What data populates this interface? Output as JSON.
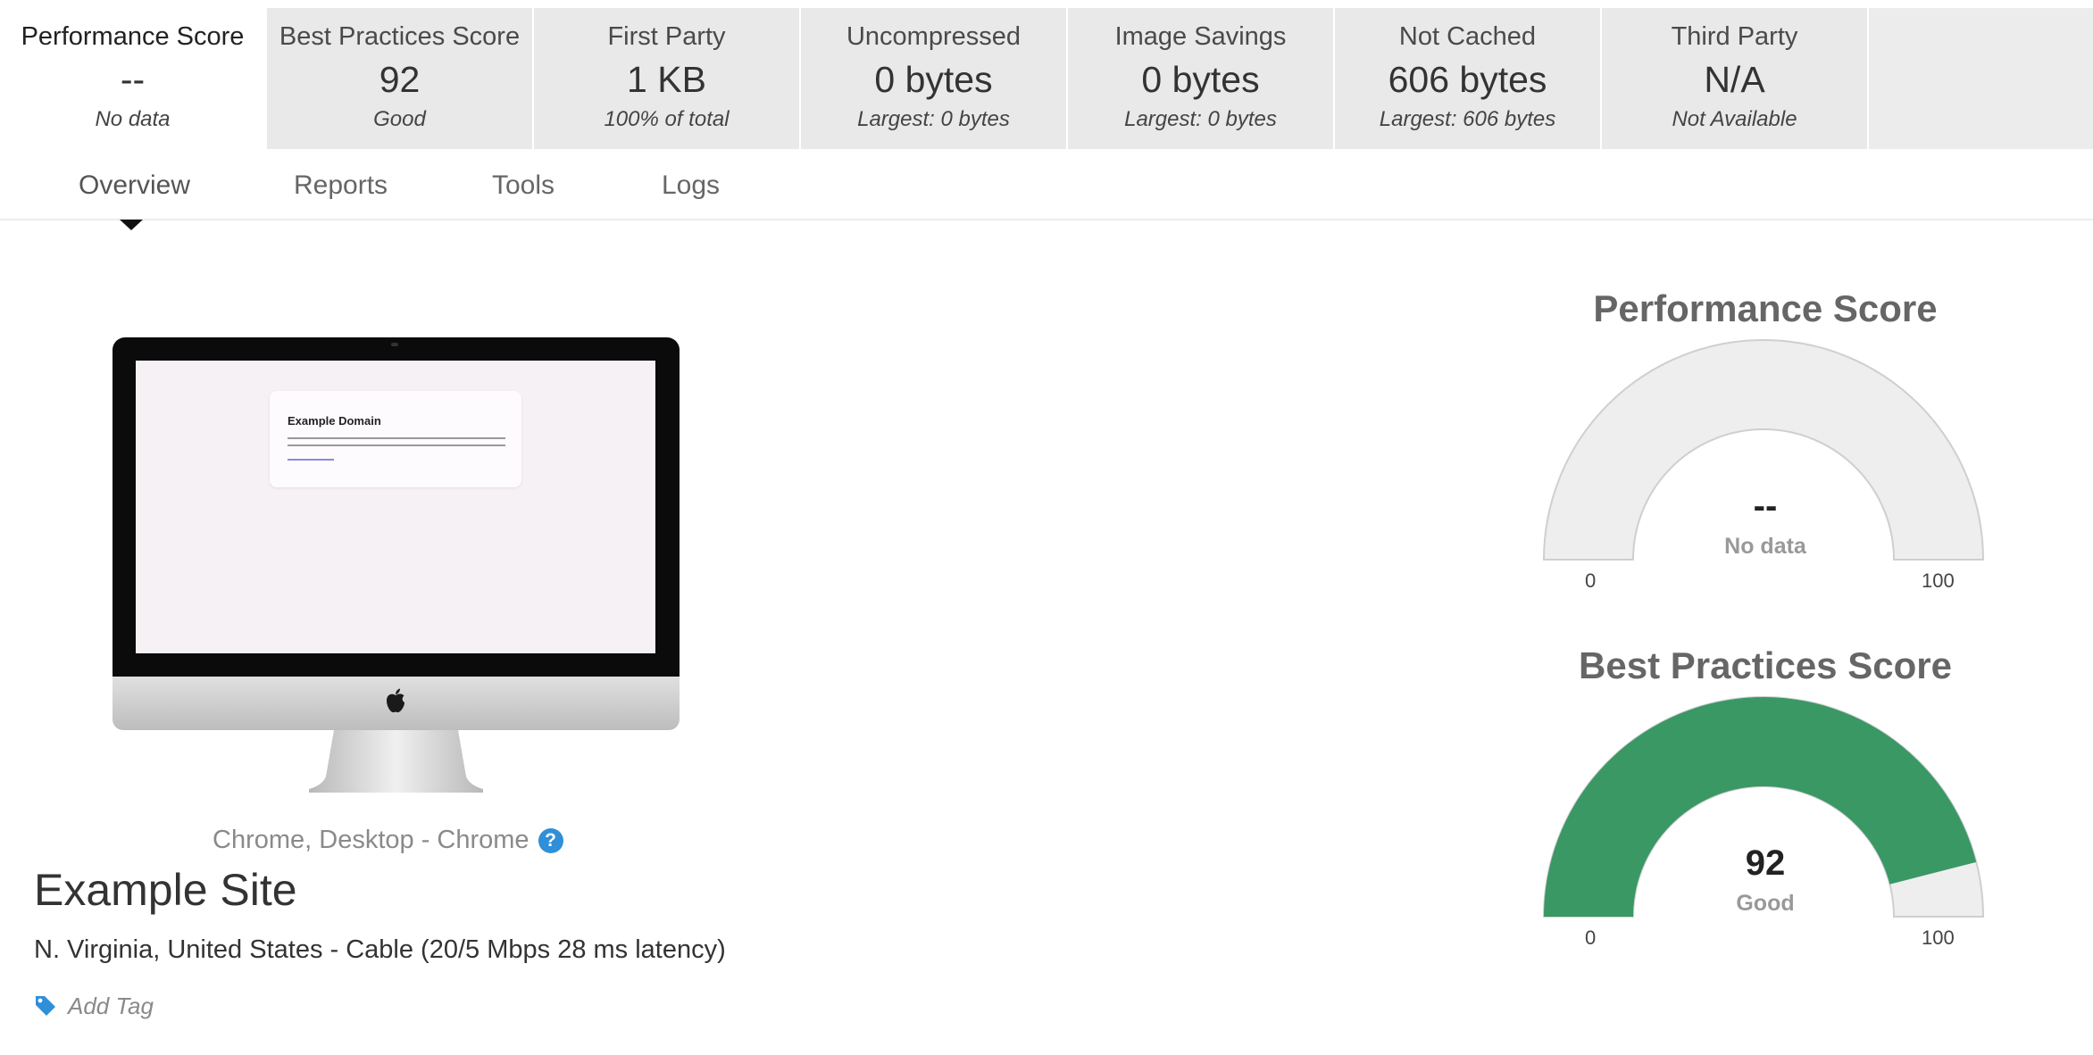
{
  "metrics": [
    {
      "label": "Performance Score",
      "value": "--",
      "sub": "No data"
    },
    {
      "label": "Best Practices Score",
      "value": "92",
      "sub": "Good"
    },
    {
      "label": "First Party",
      "value": "1 KB",
      "sub": "100% of total"
    },
    {
      "label": "Uncompressed",
      "value": "0 bytes",
      "sub": "Largest: 0 bytes"
    },
    {
      "label": "Image Savings",
      "value": "0 bytes",
      "sub": "Largest: 0 bytes"
    },
    {
      "label": "Not Cached",
      "value": "606 bytes",
      "sub": "Largest: 606 bytes"
    },
    {
      "label": "Third Party",
      "value": "N/A",
      "sub": "Not Available"
    }
  ],
  "tabs": [
    {
      "label": "Overview",
      "active": true
    },
    {
      "label": "Reports",
      "active": false
    },
    {
      "label": "Tools",
      "active": false
    },
    {
      "label": "Logs",
      "active": false
    }
  ],
  "screenshot": {
    "page_title": "Example Domain"
  },
  "test_info": {
    "browser": "Chrome, Desktop - Chrome",
    "site_name": "Example Site",
    "location": "N. Virginia, United States - Cable (20/5 Mbps 28 ms latency)",
    "add_tag": "Add Tag"
  },
  "gauges": {
    "performance": {
      "title": "Performance Score",
      "value": "--",
      "note": "No data",
      "score": null,
      "min": "0",
      "max": "100"
    },
    "best_practices": {
      "title": "Best Practices Score",
      "value": "92",
      "note": "Good",
      "score": 92,
      "min": "0",
      "max": "100"
    }
  },
  "colors": {
    "good": "#3a9865",
    "gauge_bg": "#eeeeee",
    "accent": "#2f8fd8"
  },
  "icons": {
    "help": "help-circle-icon",
    "tag": "tag-icon",
    "apple": "apple-logo-icon"
  }
}
